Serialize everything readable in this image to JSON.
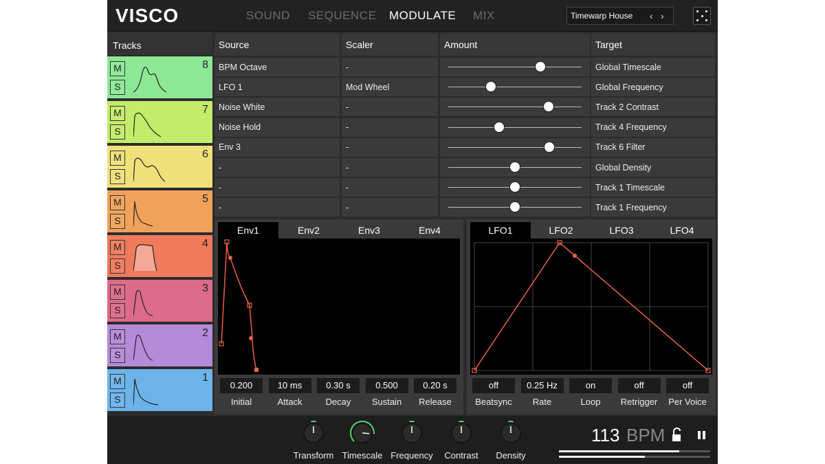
{
  "header": {
    "logo": "VISCO",
    "nav": [
      "SOUND",
      "SEQUENCE",
      "MODULATE",
      "MIX"
    ],
    "active_nav": "MODULATE",
    "preset_name": "Timewarp House",
    "prev_icon": "chevron-left-icon",
    "next_icon": "chevron-right-icon",
    "dice_icon": "dice-icon"
  },
  "tracks": {
    "title": "Tracks",
    "mute_label": "M",
    "solo_label": "S",
    "items": [
      {
        "number": "8",
        "color": "#8de895"
      },
      {
        "number": "7",
        "color": "#c3ec6a"
      },
      {
        "number": "6",
        "color": "#f0e07a"
      },
      {
        "number": "5",
        "color": "#f0a25a"
      },
      {
        "number": "4",
        "color": "#ef7a5c"
      },
      {
        "number": "3",
        "color": "#dc6b8a"
      },
      {
        "number": "2",
        "color": "#b58ad8"
      },
      {
        "number": "1",
        "color": "#6cb3ea"
      }
    ]
  },
  "matrix": {
    "headers": {
      "source": "Source",
      "scaler": "Scaler",
      "amount": "Amount",
      "target": "Target"
    },
    "rows": [
      {
        "source": "BPM Octave",
        "scaler": "-",
        "amount": 0.69,
        "target": "Global Timescale"
      },
      {
        "source": "LFO 1",
        "scaler": "Mod Wheel",
        "amount": 0.32,
        "target": "Global Frequency"
      },
      {
        "source": "Noise White",
        "scaler": "-",
        "amount": 0.75,
        "target": "Track 2 Contrast"
      },
      {
        "source": "Noise Hold",
        "scaler": "-",
        "amount": 0.38,
        "target": "Track 4 Frequency"
      },
      {
        "source": "Env 3",
        "scaler": "-",
        "amount": 0.76,
        "target": "Track 6 Filter"
      },
      {
        "source": "-",
        "scaler": "-",
        "amount": 0.5,
        "target": "Global Density"
      },
      {
        "source": "-",
        "scaler": "-",
        "amount": 0.5,
        "target": "Track 1 Timescale"
      },
      {
        "source": "-",
        "scaler": "-",
        "amount": 0.5,
        "target": "Track 1 Frequency"
      }
    ]
  },
  "env": {
    "tabs": [
      "Env1",
      "Env2",
      "Env3",
      "Env4"
    ],
    "active_tab": "Env1",
    "params": [
      {
        "value": "0.200",
        "label": "Initial"
      },
      {
        "value": "10 ms",
        "label": "Attack"
      },
      {
        "value": "0.30 s",
        "label": "Decay"
      },
      {
        "value": "0.500",
        "label": "Sustain"
      },
      {
        "value": "0.20 s",
        "label": "Release"
      }
    ],
    "curve_color": "#e8624a"
  },
  "lfo": {
    "tabs": [
      "LFO1",
      "LFO2",
      "LFO3",
      "LFO4"
    ],
    "active_tab": "LFO1",
    "params": [
      {
        "value": "off",
        "label": "Beatsync"
      },
      {
        "value": "0.25 Hz",
        "label": "Rate"
      },
      {
        "value": "on",
        "label": "Loop"
      },
      {
        "value": "off",
        "label": "Retrigger"
      },
      {
        "value": "off",
        "label": "Per Voice"
      }
    ]
  },
  "footer": {
    "knobs": [
      {
        "label": "Transform",
        "value": 0.5
      },
      {
        "label": "Timescale",
        "value": 0.85
      },
      {
        "label": "Frequency",
        "value": 0.5
      },
      {
        "label": "Contrast",
        "value": 0.5
      },
      {
        "label": "Density",
        "value": 0.5
      }
    ],
    "bpm_value": "113",
    "bpm_unit": "BPM",
    "lock_icon": "unlock-icon",
    "pause_icon": "pause-icon",
    "accent": "#55d36a"
  }
}
